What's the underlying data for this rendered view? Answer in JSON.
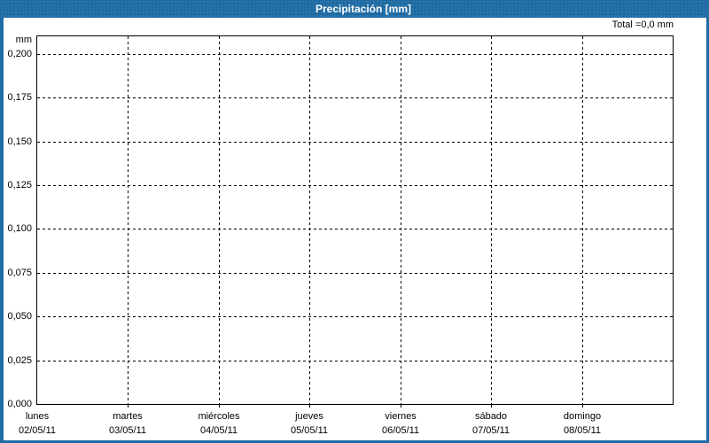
{
  "header": {
    "title": "Precipitación [mm]"
  },
  "summary": {
    "total_label": "Total =0,0 mm"
  },
  "y_axis": {
    "unit": "mm",
    "ticks": [
      {
        "label": "0,200",
        "value": 0.2
      },
      {
        "label": "0,175",
        "value": 0.175
      },
      {
        "label": "0,150",
        "value": 0.15
      },
      {
        "label": "0,125",
        "value": 0.125
      },
      {
        "label": "0,100",
        "value": 0.1
      },
      {
        "label": "0,075",
        "value": 0.075
      },
      {
        "label": "0,050",
        "value": 0.05
      },
      {
        "label": "0,025",
        "value": 0.025
      },
      {
        "label": "0,000",
        "value": 0.0
      }
    ]
  },
  "x_axis": {
    "days": [
      {
        "name": "lunes",
        "date": "02/05/11"
      },
      {
        "name": "martes",
        "date": "03/05/11"
      },
      {
        "name": "miércoles",
        "date": "04/05/11"
      },
      {
        "name": "jueves",
        "date": "05/05/11"
      },
      {
        "name": "viernes",
        "date": "06/05/11"
      },
      {
        "name": "sábado",
        "date": "07/05/11"
      },
      {
        "name": "domingo",
        "date": "08/05/11"
      }
    ]
  },
  "colors": {
    "frame_blue": "#1f6ba3",
    "title_text": "#ffffff",
    "axis_text": "#000000",
    "grid": "#000000",
    "background": "#ffffff"
  },
  "chart_data": {
    "type": "bar",
    "title": "Precipitación [mm]",
    "ylabel": "mm",
    "ylim": [
      0,
      0.21
    ],
    "ytick_step": 0.025,
    "categories": [
      "lunes 02/05/11",
      "martes 03/05/11",
      "miércoles 04/05/11",
      "jueves 05/05/11",
      "viernes 06/05/11",
      "sábado 07/05/11",
      "domingo 08/05/11"
    ],
    "values": [
      0,
      0,
      0,
      0,
      0,
      0,
      0
    ],
    "total_mm": 0.0,
    "grid": "dashed-horizontal-and-vertical",
    "legend_position": "none"
  }
}
